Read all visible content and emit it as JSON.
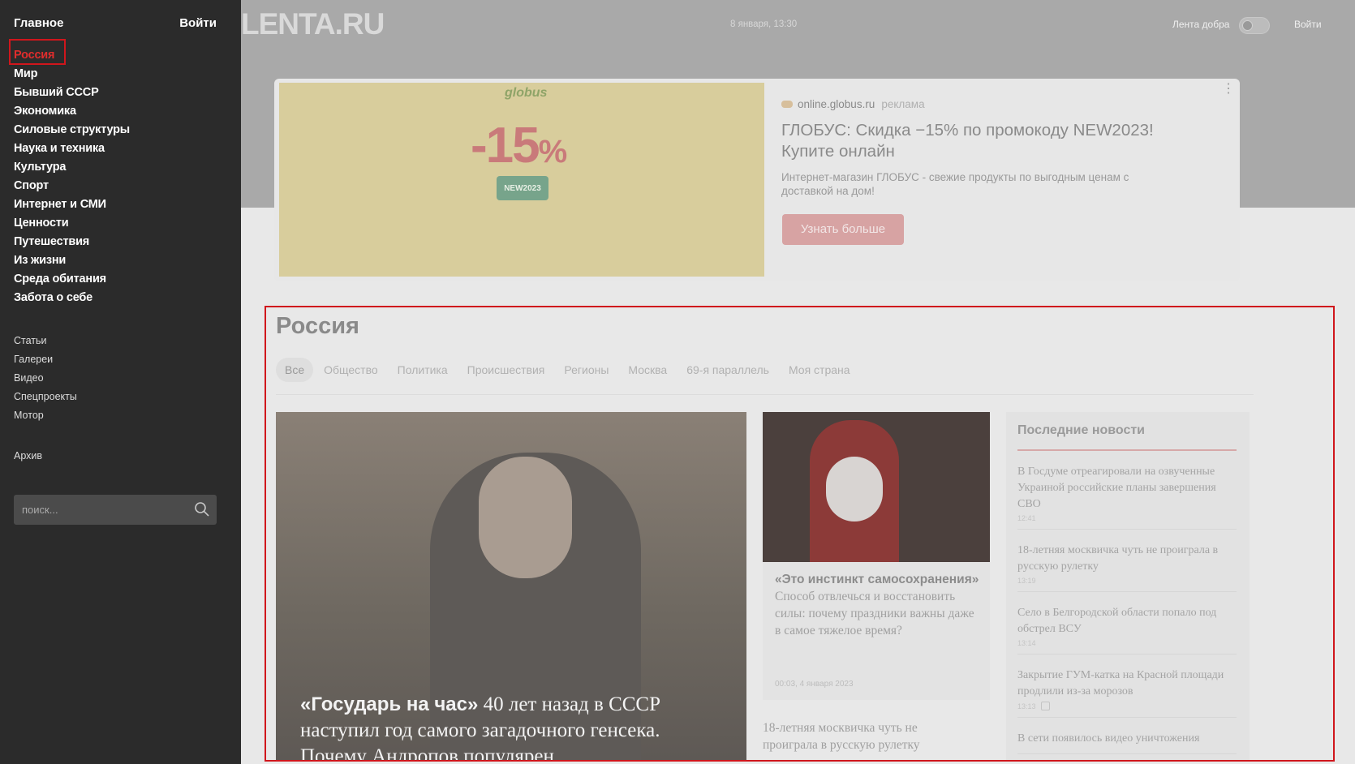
{
  "sidebar": {
    "main": "Главное",
    "login": "Войти",
    "nav": [
      "Россия",
      "Мир",
      "Бывший СССР",
      "Экономика",
      "Силовые структуры",
      "Наука и техника",
      "Культура",
      "Спорт",
      "Интернет и СМИ",
      "Ценности",
      "Путешествия",
      "Из жизни",
      "Среда обитания",
      "Забота о себе"
    ],
    "sub": [
      "Статьи",
      "Галереи",
      "Видео",
      "Спецпроекты",
      "Мотор"
    ],
    "archive": "Архив",
    "search_placeholder": "поиск..."
  },
  "header": {
    "logo": "LENTA.RU",
    "date": "8 января, 13:30",
    "lenta_dobra": "Лента добра",
    "login": "Войти"
  },
  "ad": {
    "brand": "globus",
    "percent": "-15",
    "percent_sign": "%",
    "promo": "NEW2023",
    "source": "online.globus.ru",
    "label": "реклама",
    "title": "ГЛОБУС: Скидка −15% по промокоду NEW2023! Купите онлайн",
    "text": "Интернет-магазин ГЛОБУС - свежие продукты по выгодным ценам с доставкой на дом!",
    "button": "Узнать больше",
    "menu": "⋮"
  },
  "section": {
    "title": "Россия",
    "tabs": [
      "Все",
      "Общество",
      "Политика",
      "Происшествия",
      "Регионы",
      "Москва",
      "69-я параллель",
      "Моя страна"
    ],
    "main_card": {
      "bold": "«Государь на час»",
      "text": " 40 лет назад в СССР наступил год самого загадочного генсека. Почему Андропов популярен"
    },
    "mid_card": {
      "bold": "«Это инстинкт самосохранения»",
      "text": " Способ отвлечься и восстановить силы: почему праздники важны даже в самое тяжелое время?",
      "date": "00:03, 4 января 2023"
    },
    "mid_extra": "18-летняя москвичка чуть не проиграла в русскую рулетку",
    "news_title": "Последние новости",
    "news": [
      {
        "text": "В Госдуме отреагировали на озвученные Украиной российские планы завершения СВО",
        "time": "12:41"
      },
      {
        "text": "18-летняя москвичка чуть не проиграла в русскую рулетку",
        "time": "13:19"
      },
      {
        "text": "Село в Белгородской области попало под обстрел ВСУ",
        "time": "13:14"
      },
      {
        "text": "Закрытие ГУМ-катка на Красной площади продлили из-за морозов",
        "time": "13:13"
      },
      {
        "text": "В сети появилось видео уничтожения",
        "time": ""
      }
    ]
  }
}
